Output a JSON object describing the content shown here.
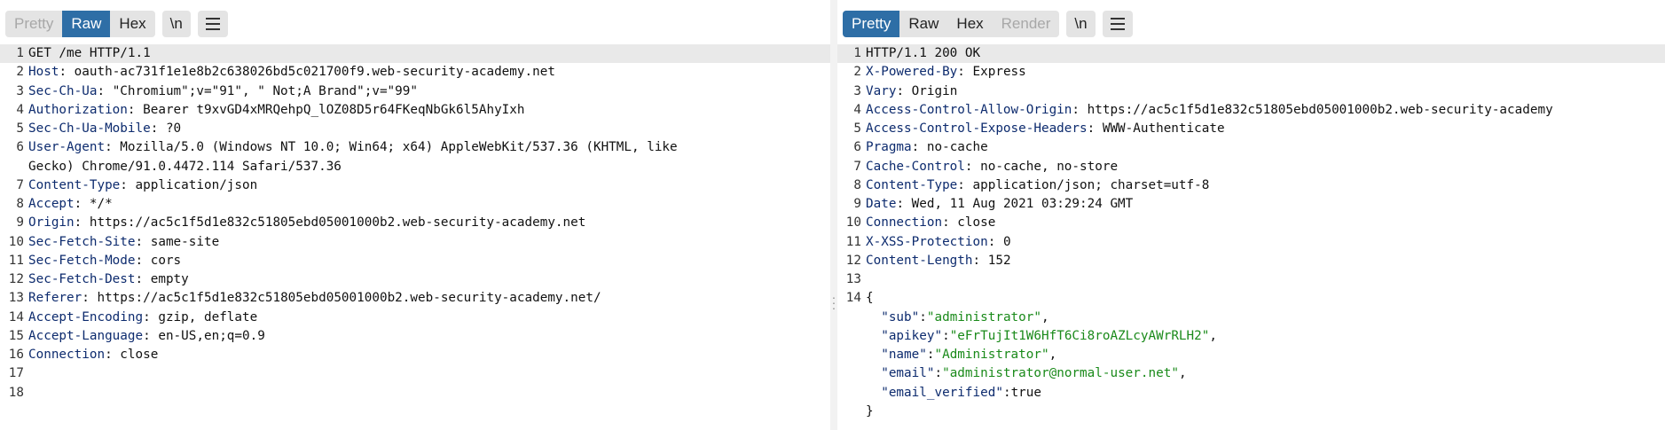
{
  "request": {
    "tabs": [
      {
        "label": "Pretty",
        "state": "disabled"
      },
      {
        "label": "Raw",
        "state": "active"
      },
      {
        "label": "Hex",
        "state": "normal"
      }
    ],
    "newline_toggle": "\\n",
    "menu_icon": "hamburger-menu-icon",
    "lines": [
      {
        "num": "1",
        "text": "GET /me HTTP/1.1"
      },
      {
        "num": "2",
        "key": "Host",
        "value": "oauth-ac731f1e1e8b2c638026bd5c021700f9.web-security-academy.net"
      },
      {
        "num": "3",
        "key": "Sec-Ch-Ua",
        "value": "\"Chromium\";v=\"91\", \" Not;A Brand\";v=\"99\""
      },
      {
        "num": "4",
        "key": "Authorization",
        "value": "Bearer t9xvGD4xMRQehpQ_lOZ08D5r64FKeqNbGk6l5AhyIxh"
      },
      {
        "num": "5",
        "key": "Sec-Ch-Ua-Mobile",
        "value": "?0"
      },
      {
        "num": "6",
        "key": "User-Agent",
        "value": "Mozilla/5.0 (Windows NT 10.0; Win64; x64) AppleWebKit/537.36 (KHTML, like"
      },
      {
        "num": "",
        "text": "Gecko) Chrome/91.0.4472.114 Safari/537.36"
      },
      {
        "num": "7",
        "key": "Content-Type",
        "value": "application/json"
      },
      {
        "num": "8",
        "key": "Accept",
        "value": "*/*"
      },
      {
        "num": "9",
        "key": "Origin",
        "value": "https://ac5c1f5d1e832c51805ebd05001000b2.web-security-academy.net"
      },
      {
        "num": "10",
        "key": "Sec-Fetch-Site",
        "value": "same-site"
      },
      {
        "num": "11",
        "key": "Sec-Fetch-Mode",
        "value": "cors"
      },
      {
        "num": "12",
        "key": "Sec-Fetch-Dest",
        "value": "empty"
      },
      {
        "num": "13",
        "key": "Referer",
        "value": "https://ac5c1f5d1e832c51805ebd05001000b2.web-security-academy.net/"
      },
      {
        "num": "14",
        "key": "Accept-Encoding",
        "value": "gzip, deflate"
      },
      {
        "num": "15",
        "key": "Accept-Language",
        "value": "en-US,en;q=0.9"
      },
      {
        "num": "16",
        "key": "Connection",
        "value": "close"
      },
      {
        "num": "17",
        "text": ""
      },
      {
        "num": "18",
        "text": ""
      }
    ]
  },
  "response": {
    "tabs": [
      {
        "label": "Pretty",
        "state": "active"
      },
      {
        "label": "Raw",
        "state": "normal"
      },
      {
        "label": "Hex",
        "state": "normal"
      },
      {
        "label": "Render",
        "state": "disabled"
      }
    ],
    "newline_toggle": "\\n",
    "menu_icon": "hamburger-menu-icon",
    "lines": [
      {
        "num": "1",
        "text": "HTTP/1.1 200 OK"
      },
      {
        "num": "2",
        "key": "X-Powered-By",
        "value": "Express"
      },
      {
        "num": "3",
        "key": "Vary",
        "value": "Origin"
      },
      {
        "num": "4",
        "key": "Access-Control-Allow-Origin",
        "value": "https://ac5c1f5d1e832c51805ebd05001000b2.web-security-academy"
      },
      {
        "num": "5",
        "key": "Access-Control-Expose-Headers",
        "value": "WWW-Authenticate"
      },
      {
        "num": "6",
        "key": "Pragma",
        "value": "no-cache"
      },
      {
        "num": "7",
        "key": "Cache-Control",
        "value": "no-cache, no-store"
      },
      {
        "num": "8",
        "key": "Content-Type",
        "value": "application/json; charset=utf-8"
      },
      {
        "num": "9",
        "key": "Date",
        "value": "Wed, 11 Aug 2021 03:29:24 GMT"
      },
      {
        "num": "10",
        "key": "Connection",
        "value": "close"
      },
      {
        "num": "11",
        "key": "X-XSS-Protection",
        "value": "0"
      },
      {
        "num": "12",
        "key": "Content-Length",
        "value": "152"
      },
      {
        "num": "13",
        "text": ""
      },
      {
        "num": "14",
        "text": "{"
      },
      {
        "num": "",
        "jkey": "\"sub\"",
        "jval": "\"administrator\"",
        "jval_type": "string",
        "trail": ","
      },
      {
        "num": "",
        "jkey": "\"apikey\"",
        "jval": "\"eFrTujIt1W6HfT6Ci8roAZLcyAWrRLH2\"",
        "jval_type": "string",
        "trail": ","
      },
      {
        "num": "",
        "jkey": "\"name\"",
        "jval": "\"Administrator\"",
        "jval_type": "string",
        "trail": ","
      },
      {
        "num": "",
        "jkey": "\"email\"",
        "jval": "\"administrator@normal-user.net\"",
        "jval_type": "string",
        "trail": ","
      },
      {
        "num": "",
        "jkey": "\"email_verified\"",
        "jval": "true",
        "jval_type": "plain",
        "trail": ""
      },
      {
        "num": "",
        "text": "}"
      }
    ]
  },
  "colors": {
    "active_tab": "#2e6ea6",
    "header_key": "#0d2b6e",
    "json_string": "#1a8a1a",
    "highlight_line": "#e9e9e9"
  }
}
